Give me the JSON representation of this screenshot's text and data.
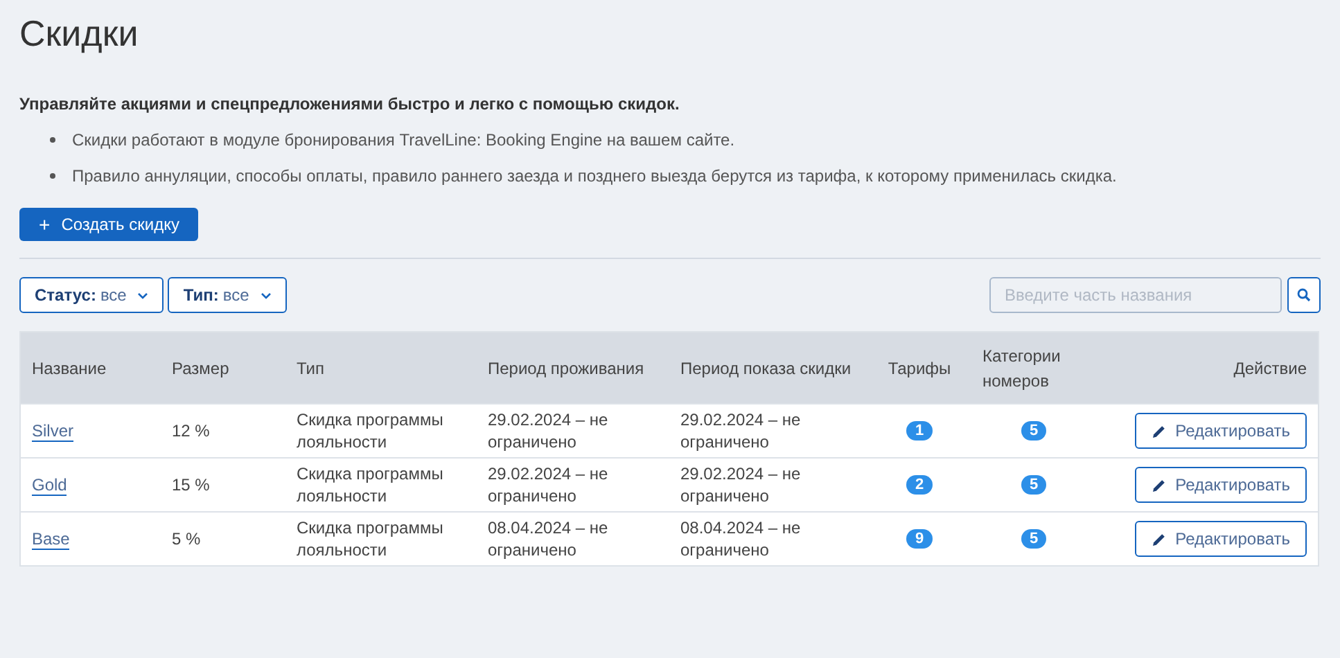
{
  "title": "Скидки",
  "intro": {
    "heading": "Управляйте акциями и спецпредложениями быстро и легко с помощью скидок.",
    "bullets": [
      "Скидки работают в модуле бронирования TravelLine: Booking Engine на вашем сайте.",
      "Правило аннуляции, способы оплаты, правило раннего заезда и позднего выезда берутся из тарифа, к которому применилась скидка."
    ]
  },
  "create_button": {
    "icon": "+",
    "label": "Создать скидку"
  },
  "filters": [
    {
      "label": "Статус:",
      "value": "все"
    },
    {
      "label": "Тип:",
      "value": "все"
    }
  ],
  "search": {
    "placeholder": "Введите часть названия"
  },
  "table": {
    "columns": [
      "Название",
      "Размер",
      "Тип",
      "Период проживания",
      "Период показа скидки",
      "Тарифы",
      "Категории номеров",
      "Действие"
    ],
    "rows": [
      {
        "name": "Silver",
        "size": "12 %",
        "type": "Скидка программы лояльности",
        "stay_period": "29.02.2024 – не ограничено",
        "display_period": "29.02.2024 – не ограничено",
        "rates": "1",
        "room_categories": "5",
        "action": "Редактировать"
      },
      {
        "name": "Gold",
        "size": "15 %",
        "type": "Скидка программы лояльности",
        "stay_period": "29.02.2024 – не ограничено",
        "display_period": "29.02.2024 – не ограничено",
        "rates": "2",
        "room_categories": "5",
        "action": "Редактировать"
      },
      {
        "name": "Base",
        "size": "5 %",
        "type": "Скидка программы лояльности",
        "stay_period": "08.04.2024 – не ограничено",
        "display_period": "08.04.2024 – не ограничено",
        "rates": "9",
        "room_categories": "5",
        "action": "Редактировать"
      }
    ]
  }
}
